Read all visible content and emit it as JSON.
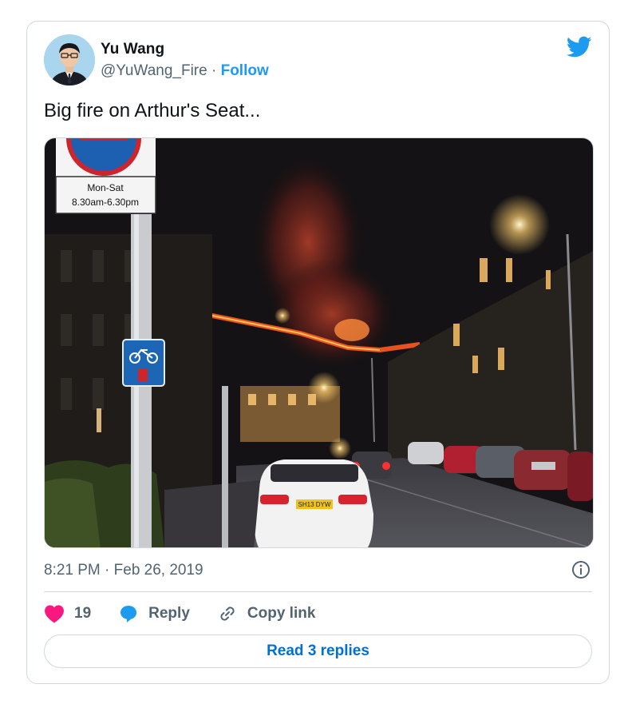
{
  "author": {
    "name": "Yu Wang",
    "handle": "@YuWang_Fire",
    "separator": " · ",
    "follow_label": "Follow"
  },
  "tweet": {
    "text": "Big fire on Arthur's Seat...",
    "timestamp": "8:21 PM · Feb 26, 2019"
  },
  "photo": {
    "sign_text_line1": "Mon-Sat",
    "sign_text_line2": "8.30am-6.30pm",
    "plate_text": "SH13 DYW"
  },
  "actions": {
    "like_count": "19",
    "reply_label": "Reply",
    "copy_link_label": "Copy link"
  },
  "read_replies_label": "Read 3 replies",
  "colors": {
    "accent": "#1d9bf0",
    "like": "#f91880",
    "link_button": "#006fd6"
  },
  "icons": [
    "twitter-bird-icon",
    "info-icon",
    "heart-icon",
    "reply-bubble-icon",
    "link-icon"
  ]
}
